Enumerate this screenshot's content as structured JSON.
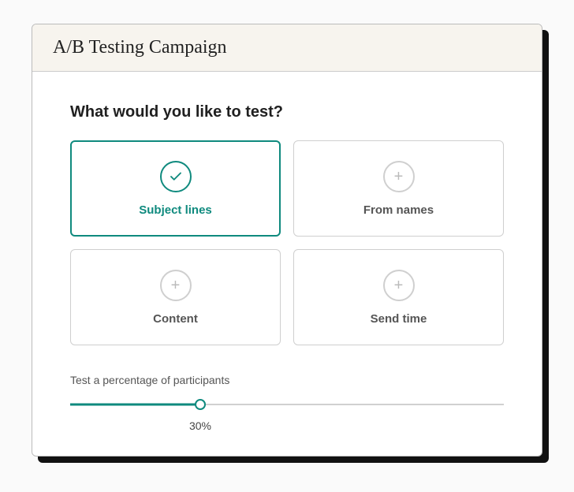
{
  "header": {
    "title": "A/B Testing Campaign"
  },
  "question": "What would you like to test?",
  "options": [
    {
      "label": "Subject lines",
      "selected": true
    },
    {
      "label": "From names",
      "selected": false
    },
    {
      "label": "Content",
      "selected": false
    },
    {
      "label": "Send time",
      "selected": false
    }
  ],
  "slider": {
    "label": "Test a percentage of participants",
    "value_display": "30%",
    "percent": 30
  },
  "colors": {
    "accent": "#0f8a7e"
  }
}
